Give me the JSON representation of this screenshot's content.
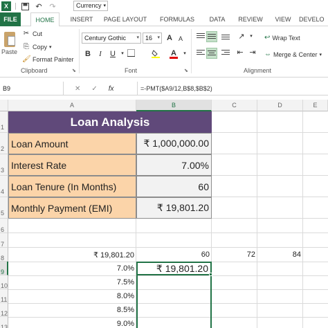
{
  "qat": {
    "app_logo": "X",
    "save_icon": "save-icon",
    "undo_icon": "undo-icon",
    "redo_icon": "redo-icon",
    "number_format": "Currency"
  },
  "tabs": [
    "FILE",
    "HOME",
    "INSERT",
    "PAGE LAYOUT",
    "FORMULAS",
    "DATA",
    "REVIEW",
    "VIEW",
    "DEVELO"
  ],
  "ribbon": {
    "clipboard": {
      "paste": "Paste",
      "cut": "Cut",
      "copy": "Copy",
      "format_painter": "Format Painter",
      "label": "Clipboard"
    },
    "font": {
      "name": "Century Gothic",
      "size": "16",
      "bold": "B",
      "italic": "I",
      "underline": "U",
      "font_color_glyph": "A",
      "label": "Font"
    },
    "alignment": {
      "wrap_text": "Wrap Text",
      "merge_center": "Merge & Center",
      "label": "Alignment"
    }
  },
  "formula_bar": {
    "name_box": "B9",
    "cancel": "✕",
    "enter": "✓",
    "fx": "fx",
    "formula": "=-PMT($A9/12,B$8,$B$2)"
  },
  "columns": [
    "A",
    "B",
    "C",
    "D",
    "E"
  ],
  "rows": [
    "1",
    "2",
    "3",
    "4",
    "5",
    "6",
    "7",
    "8",
    "9",
    "10",
    "11",
    "12",
    "13"
  ],
  "sheet": {
    "title": "Loan Analysis",
    "loan_amount_label": "Loan Amount",
    "loan_amount_value": "₹ 1,000,000.00",
    "interest_rate_label": "Interest Rate",
    "interest_rate_value": "7.00%",
    "tenure_label": "Loan Tenure (In Months)",
    "tenure_value": "60",
    "emi_label": "Monthly Payment (EMI)",
    "emi_value": "₹ 19,801.20",
    "a8": "₹ 19,801.20",
    "b8": "60",
    "c8": "72",
    "d8": "84",
    "rates": [
      "7.0%",
      "7.5%",
      "8.0%",
      "8.5%",
      "9.0%"
    ],
    "b9": "₹ 19,801.20"
  }
}
